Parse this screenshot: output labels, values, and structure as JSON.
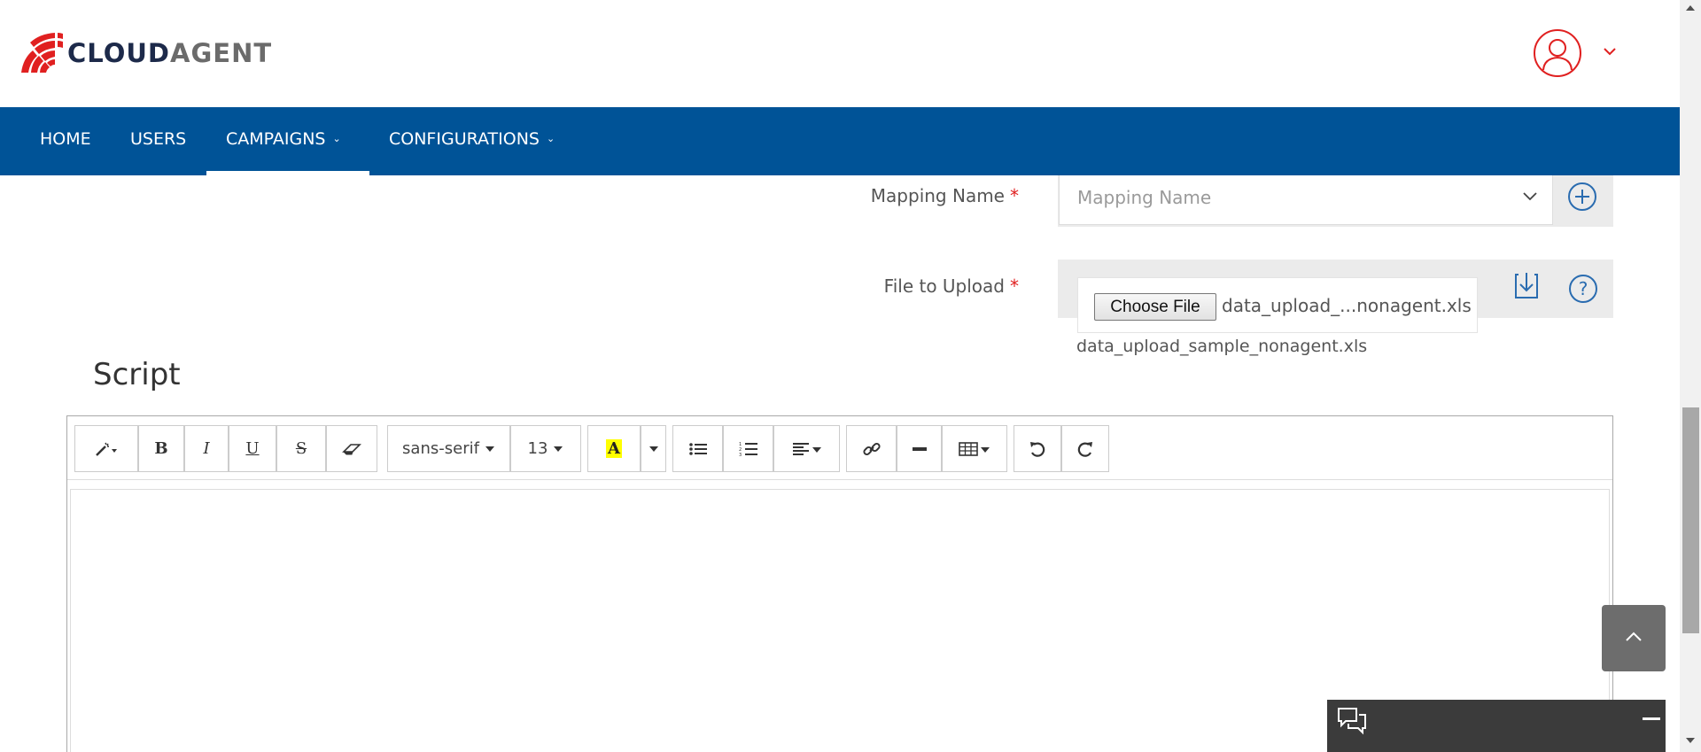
{
  "brand": {
    "name_part1": "CLOUD",
    "name_part2": "AGENT",
    "logo_icon": "fan-logo-icon",
    "colors": {
      "red": "#e02020",
      "dark": "#1d2a4a",
      "grey": "#6b6b6b"
    }
  },
  "user_menu": {
    "icon": "user-avatar-icon",
    "caret_icon": "chevron-down-icon"
  },
  "nav": {
    "background": "#005397",
    "items": [
      {
        "label": "HOME",
        "has_dropdown": false
      },
      {
        "label": "USERS",
        "has_dropdown": false
      },
      {
        "label": "CAMPAIGNS",
        "has_dropdown": true,
        "active": true
      },
      {
        "label": "CONFIGURATIONS",
        "has_dropdown": true
      }
    ]
  },
  "form": {
    "mapping_name": {
      "label": "Mapping Name",
      "required_mark": "*",
      "placeholder": "Mapping Name",
      "add_icon": "plus-circle-icon"
    },
    "file_upload": {
      "label": "File to Upload",
      "required_mark": "*",
      "button_label": "Choose File",
      "chosen_file": "data_upload_...nonagent.xls",
      "download_icon": "download-icon",
      "help_symbol": "?",
      "sample_file": "data_upload_sample_nonagent.xls"
    }
  },
  "script": {
    "title": "Script",
    "toolbar": {
      "font_family": "sans-serif",
      "font_size": "13",
      "bold": "B",
      "italic": "I",
      "underline": "U",
      "strike": "S",
      "highlight": "A",
      "highlight_color": "#ffff00"
    }
  },
  "floating": {
    "scroll_top_icon": "chevron-up-icon",
    "chat_icon": "chat-bubbles-icon"
  }
}
